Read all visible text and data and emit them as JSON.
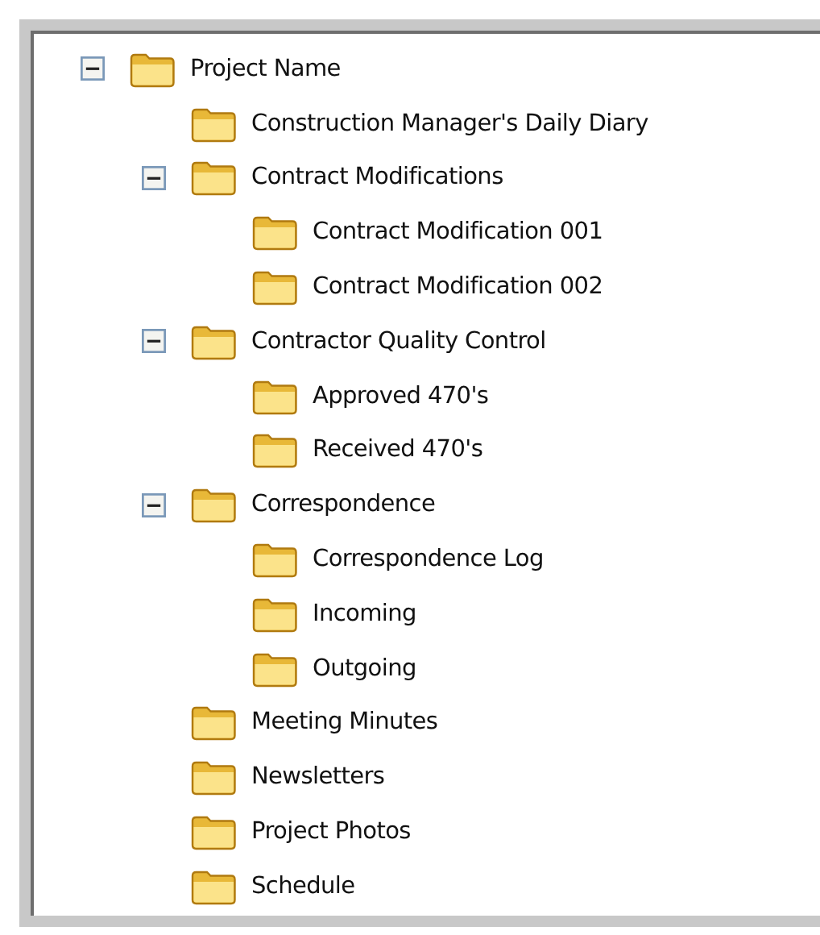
{
  "tree": [
    {
      "label": "Project Name",
      "expanded": true,
      "children": [
        {
          "label": "Construction Manager's Daily Diary"
        },
        {
          "label": "Contract Modifications",
          "expanded": true,
          "children": [
            {
              "label": "Contract Modification 001"
            },
            {
              "label": "Contract Modification 002"
            }
          ]
        },
        {
          "label": "Contractor Quality Control",
          "expanded": true,
          "children": [
            {
              "label": "Approved 470's"
            },
            {
              "label": "Received 470's"
            }
          ]
        },
        {
          "label": "Correspondence",
          "expanded": true,
          "children": [
            {
              "label": "Correspondence Log"
            },
            {
              "label": "Incoming"
            },
            {
              "label": "Outgoing"
            }
          ]
        },
        {
          "label": "Meeting Minutes"
        },
        {
          "label": "Newsletters"
        },
        {
          "label": "Project Photos"
        },
        {
          "label": "Schedule"
        }
      ]
    }
  ]
}
